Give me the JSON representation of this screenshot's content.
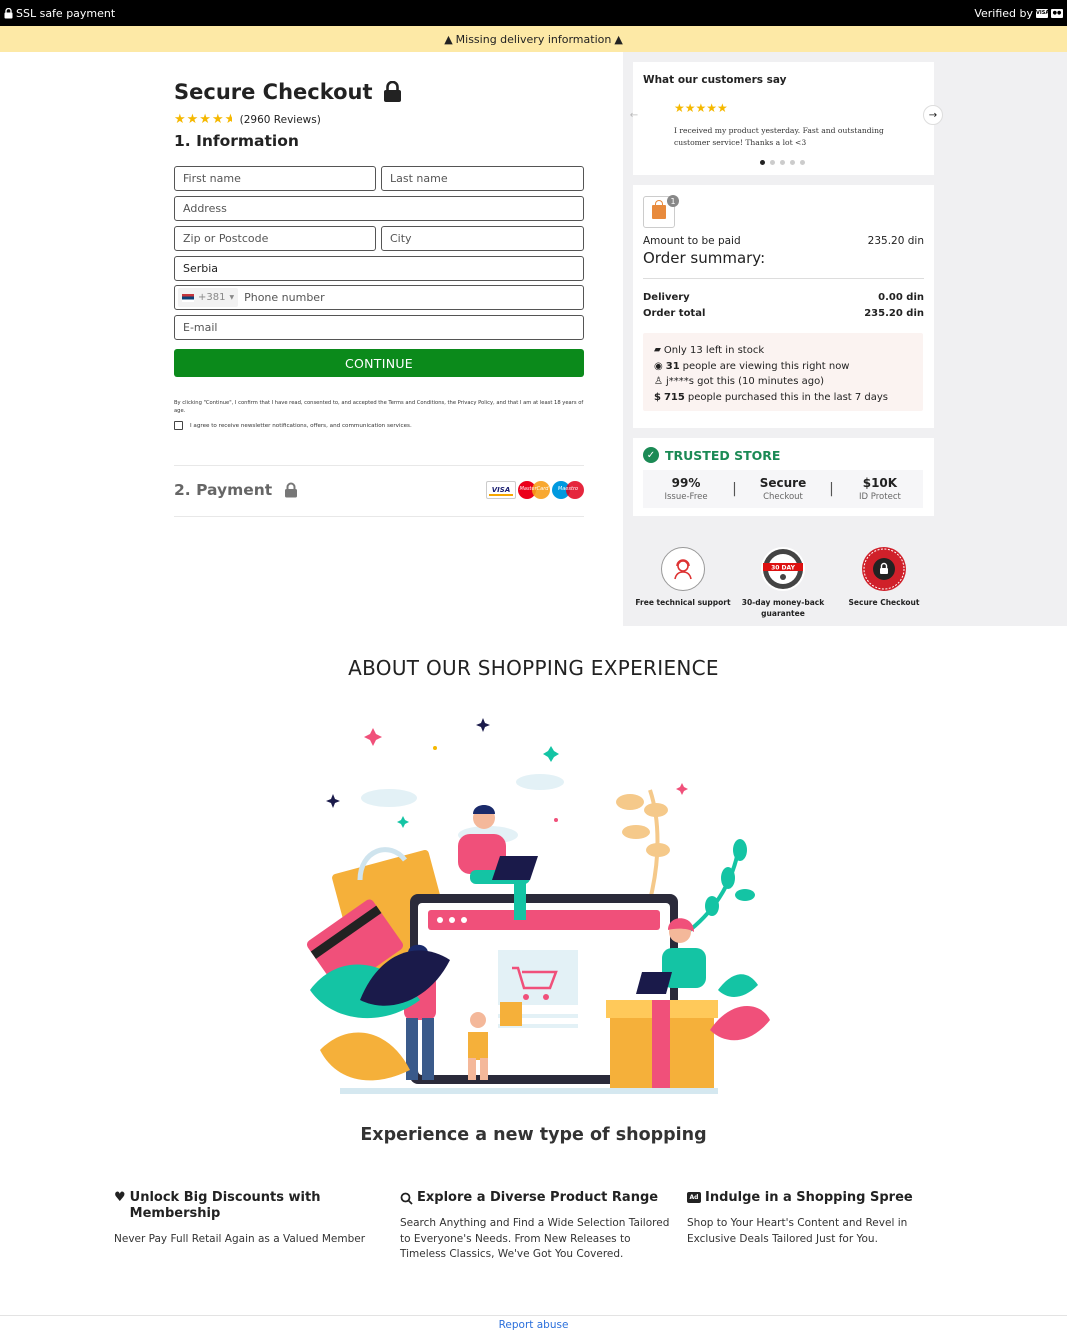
{
  "topbar": {
    "left_text": "SSL safe payment",
    "right_text": "Verified by"
  },
  "warning": {
    "text": "Missing delivery information"
  },
  "checkout": {
    "title": "Secure Checkout",
    "rating_stars": 4.5,
    "reviews": "(2960 Reviews)",
    "section_info": "1. Information",
    "fields": {
      "first_name_placeholder": "First name",
      "last_name_placeholder": "Last name",
      "address_placeholder": "Address",
      "zip_placeholder": "Zip or Postcode",
      "city_placeholder": "City",
      "country_value": "Serbia",
      "phone_prefix": "+381",
      "phone_placeholder": "Phone number",
      "email_placeholder": "E-mail"
    },
    "continue_label": "CONTINUE",
    "legal_text": "By clicking \"Continue\", I confirm that I have read, consented to, and accepted the Terms and Conditions, the Privacy Policy, and that I am at least 18 years of age.",
    "newsletter_text": "I agree to receive newsletter notifications, offers, and communication services.",
    "section_payment": "2. Payment",
    "payment_cards": [
      "VISA",
      "MasterCard",
      "Maestro"
    ]
  },
  "reviews_panel": {
    "title": "What our customers say",
    "stars": "★★★★★",
    "quote": "I received my product yesterday. Fast and outstanding customer service! Thanks a lot <3",
    "slide_count": 5,
    "active_slide": 1
  },
  "order": {
    "cart_count": "1",
    "amount_label": "Amount to be paid",
    "amount_value": "235.20 din",
    "summary_title": "Order summary:",
    "delivery_label": "Delivery",
    "delivery_value": "0.00 din",
    "total_label": "Order total",
    "total_value": "235.20 din",
    "stock_text": "Only 13 left in stock",
    "viewing_count": "31",
    "viewing_text": "people are viewing this right now",
    "recent_text": "j****s got this (10 minutes ago)",
    "purchased_count": "715",
    "purchased_text": "people purchased this in the last 7 days"
  },
  "trusted": {
    "title": "TRUSTED STORE",
    "stats": [
      {
        "value": "99%",
        "label": "Issue-Free"
      },
      {
        "value": "Secure",
        "label": "Checkout"
      },
      {
        "value": "$10K",
        "label": "ID Protect"
      }
    ]
  },
  "badges": [
    {
      "label": "Free technical support",
      "icon": "support-agent-icon"
    },
    {
      "label": "30-day money-back guarantee",
      "icon": "money-back-seal-icon",
      "seal_text": "30 DAY"
    },
    {
      "label": "Secure Checkout",
      "icon": "secure-checkout-seal-icon"
    }
  ],
  "about": {
    "title": "ABOUT OUR SHOPPING EXPERIENCE",
    "subtitle": "Experience a new type of shopping"
  },
  "features": [
    {
      "icon": "heart-icon",
      "title": "Unlock Big Discounts with Membership",
      "desc": "Never Pay Full Retail Again as a Valued Member"
    },
    {
      "icon": "search-icon",
      "title": "Explore a Diverse Product Range",
      "desc": "Search Anything and Find a Wide Selection Tailored to Everyone's Needs. From New Releases to Timeless Classics, We've Got You Covered."
    },
    {
      "icon": "ad-icon",
      "title": "Indulge in a Shopping Spree",
      "desc": "Shop to Your Heart's Content and Revel in Exclusive Deals Tailored Just for You."
    }
  ],
  "footer": {
    "report_label": "Report abuse"
  },
  "colors": {
    "primary_green": "#0b8a1b",
    "trust_green": "#1b8a55",
    "warning_bg": "#fde9a6",
    "link_blue": "#2a6fdb"
  }
}
